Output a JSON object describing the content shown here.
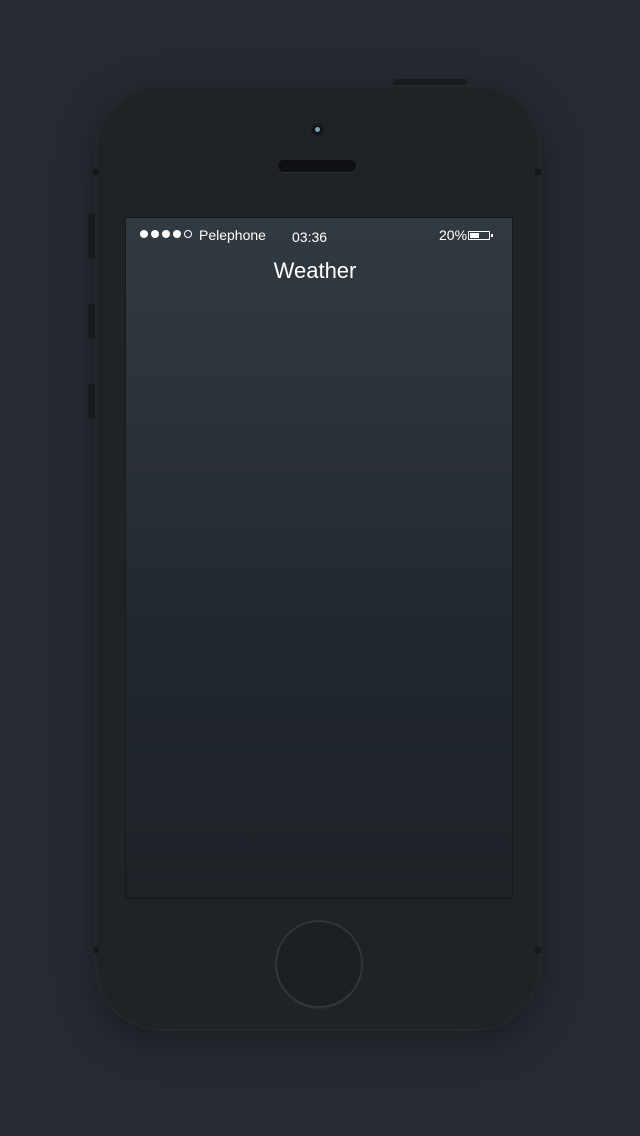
{
  "status_bar": {
    "signal_total": 5,
    "signal_filled": 4,
    "carrier": "Pelephone",
    "time": "03:36",
    "battery_percent_label": "20%",
    "battery_level": 0.5
  },
  "nav": {
    "title": "Weather"
  },
  "colors": {
    "background": "#262b32",
    "phone_body": "#1f2327",
    "screen_top": "#323a41",
    "screen_bottom": "#1c2226",
    "text": "#ffffff"
  },
  "icons": {
    "battery": "battery-icon",
    "signal": "signal-strength-icon",
    "camera": "front-camera",
    "home": "home-button"
  }
}
